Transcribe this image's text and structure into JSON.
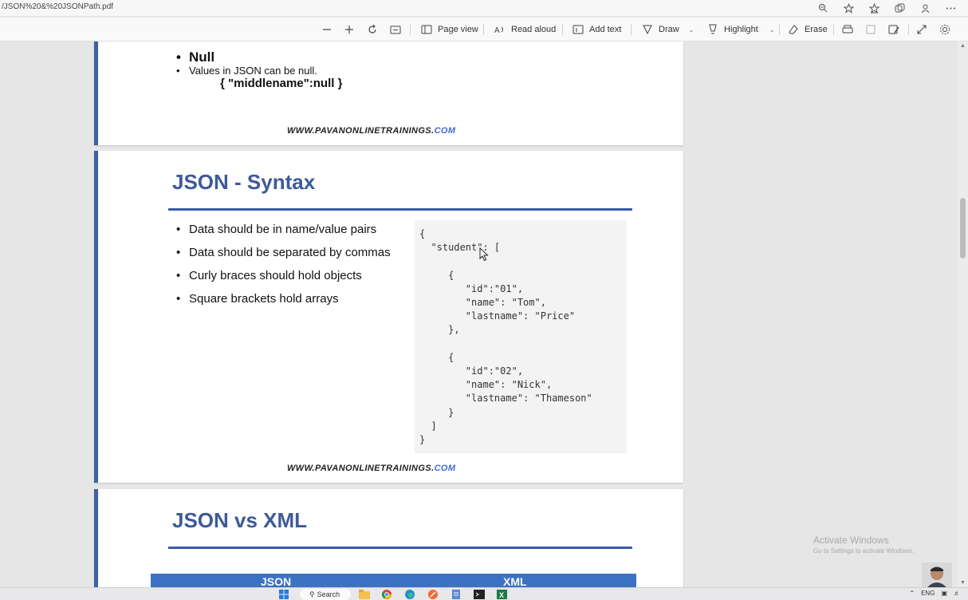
{
  "browser": {
    "url": "/JSON%20&%20JSONPath.pdf",
    "icons": [
      "zoom-icon",
      "favorite-icon",
      "favorites-icon",
      "collections-icon",
      "profile-icon",
      "more-icon"
    ]
  },
  "toolbar": {
    "page_view": "Page view",
    "read_aloud": "Read aloud",
    "add_text": "Add text",
    "draw": "Draw",
    "highlight": "Highlight",
    "erase": "Erase"
  },
  "page1": {
    "null_heading": "Null",
    "null_desc": "Values in JSON can be null.",
    "null_example": "{ \"middlename\":null }",
    "footer_main": "WWW.PAVANONLINETRAININGS.",
    "footer_com": "COM"
  },
  "page2": {
    "title": "JSON - Syntax",
    "bullets": [
      "Data should be in name/value pairs",
      "Data should be separated by commas",
      "Curly braces should hold objects",
      "Square brackets hold arrays"
    ],
    "code": "{\n  \"student\": [\n\n     {\n        \"id\":\"01\",\n        \"name\": \"Tom\",\n        \"lastname\": \"Price\"\n     },\n\n     {\n        \"id\":\"02\",\n        \"name\": \"Nick\",\n        \"lastname\": \"Thameson\"\n     }\n  ]\n}",
    "footer_main": "WWW.PAVANONLINETRAININGS.",
    "footer_com": "COM"
  },
  "page3": {
    "title": "JSON vs XML",
    "col1": "JSON",
    "col2": "XML"
  },
  "watermark": {
    "line1": "Activate Windows",
    "line2": "Go to Settings to activate Windows."
  },
  "taskbar": {
    "search": "Search",
    "lang": "ENG"
  },
  "colors": {
    "accent": "#3d5a99",
    "rule": "#3a5aa8",
    "table_header": "#3b72c4"
  }
}
